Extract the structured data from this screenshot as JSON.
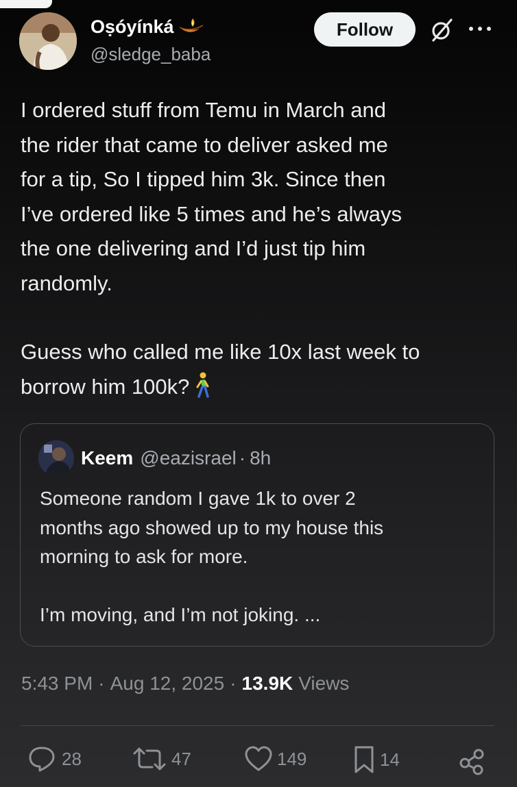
{
  "author": {
    "name": "Oṣóyínká",
    "handle": "@sledge_baba",
    "avatar_icon": "profile-photo",
    "name_emoji_icon": "diya-lamp-icon"
  },
  "actions_header": {
    "follow_label": "Follow",
    "grok_icon": "grok-icon",
    "more_icon": "more-horizontal-icon"
  },
  "tweet": {
    "paragraph1": "I ordered stuff from Temu in March and\nthe rider that came to deliver asked me\nfor a tip, So I tipped him 3k. Since then\nI’ve ordered like 5 times and he’s always\nthe one delivering and I’d just tip him\nrandomly.",
    "paragraph2": "Guess who called me like 10x last week to\nborrow him 100k?",
    "emoji_icon": "person-walking-icon"
  },
  "quote": {
    "name": "Keem",
    "handle": "@eazisrael",
    "separator": "·",
    "time": "8h",
    "paragraph1": "Someone random I gave 1k to over 2\nmonths ago showed up to my house this\nmorning to ask for more.",
    "paragraph2": "I’m moving, and I’m not joking. ..."
  },
  "meta": {
    "time": "5:43 PM",
    "separator": "·",
    "date": "Aug 12, 2025",
    "separator2": "·",
    "views_count": "13.9K",
    "views_label": "Views"
  },
  "stats": {
    "replies": "28",
    "reposts": "47",
    "likes": "149",
    "bookmarks": "14"
  },
  "colors": {
    "text_primary": "#ecedee",
    "text_secondary": "#8e9297",
    "follow_bg": "#eff3f4",
    "border": "#4a4d52"
  }
}
